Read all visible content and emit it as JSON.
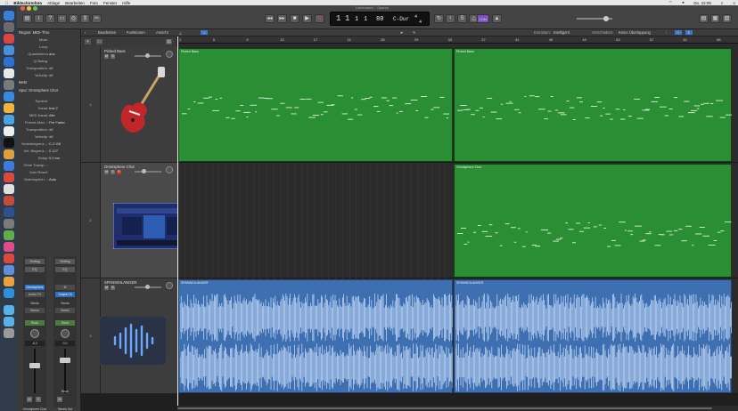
{
  "menubar": {
    "app": "Bildschirmfoto",
    "items": [
      "Ablage",
      "Bearbeiten",
      "Foto",
      "Fenster",
      "Hilfe"
    ],
    "clock": "Do. 22:05"
  },
  "window": {
    "title": "Unbenannt – Spuren"
  },
  "transport": {
    "bars": "1",
    "beat": "1",
    "div": "1",
    "tick": "1",
    "tempo": "80",
    "key": "C-Dur",
    "signature_top": "4",
    "signature_bottom": "4",
    "cpu_label": "1234"
  },
  "inspector": {
    "region_header": "Region: MIDI-Thru",
    "region_rows": [
      {
        "k": "Mute:",
        "v": ""
      },
      {
        "k": "Loop:",
        "v": ""
      },
      {
        "k": "Quantisieren",
        "v": "aus"
      },
      {
        "k": "Q-Swing:",
        "v": ""
      },
      {
        "k": "Transposition:",
        "v": "±0"
      },
      {
        "k": "Velocity:",
        "v": "±0"
      }
    ],
    "more_label": "Mehr",
    "track_header": "Spur: Omnisphere Chor",
    "track_rows": [
      {
        "k": "Symbol:",
        "v": ""
      },
      {
        "k": "Kanal:",
        "v": "Inst 2"
      },
      {
        "k": "MIDI-Kanal:",
        "v": "Alle"
      },
      {
        "k": "Freeze-Mod...:",
        "v": "Pre Fader"
      },
      {
        "k": "Transposition:",
        "v": "±0"
      },
      {
        "k": "Velocity:",
        "v": "±0"
      },
      {
        "k": "Notenbegrenz...:",
        "v": "C-2  G8"
      },
      {
        "k": "Vel.-Begrenz...:",
        "v": "0  127"
      },
      {
        "k": "Delay:",
        "v": "0,0 ms"
      },
      {
        "k": "Ohne Transp...:",
        "v": ""
      },
      {
        "k": "Kein Reset:",
        "v": ""
      },
      {
        "k": "Notenspeich...:",
        "v": "Auto"
      }
    ],
    "strip_a": {
      "setting": "Setting",
      "eq": "EQ",
      "plugin": "Omnisphere",
      "group": "Audio FX",
      "send": "Sends",
      "out": "Stereo",
      "read": "Read",
      "vol": "-6,2",
      "name": "Omnisphere Chor",
      "mute": "M",
      "solo": "S"
    },
    "strip_b": {
      "setting": "Setting",
      "eq": "EQ",
      "plugin": "Ø",
      "group": "Output Ch",
      "send": "Sends",
      "out": "Stereo",
      "read": "Read",
      "vol": "0,0",
      "name": "Stereo Out",
      "bnc": "Bnce",
      "mute": "M"
    }
  },
  "editbar": {
    "edit": "Bearbeiten",
    "functions": "Funktionen",
    "view": "Ansicht",
    "snap_label": "Einrasten:",
    "snap_value": "Intelligent",
    "drag_label": "Verschieben:",
    "drag_value": "Keine Überlappung"
  },
  "ruler": [
    "1",
    "5",
    "9",
    "13",
    "17",
    "21",
    "25",
    "29",
    "33",
    "37",
    "41",
    "45",
    "49",
    "53",
    "57",
    "61",
    "65"
  ],
  "tracks": [
    {
      "num": "1",
      "name": "Picked Bass",
      "mute": "M",
      "solo": "S"
    },
    {
      "num": "2",
      "name": "Omnisphere Chor",
      "mute": "M",
      "solo": "S",
      "rec": "R"
    },
    {
      "num": "3",
      "name": "SPANNDILANGER",
      "mute": "M",
      "solo": "S"
    }
  ],
  "regions": [
    {
      "track": 0,
      "label": "Picked Bass"
    },
    {
      "track": 0,
      "label": "Picked Bass"
    },
    {
      "track": 1,
      "label": "Omnisphere Chor"
    },
    {
      "track": 2,
      "label": "SPANNDILANGER"
    },
    {
      "track": 2,
      "label": "SPANNDILANGER"
    }
  ],
  "colors": {
    "midi": "#2a8f34",
    "audio": "#3e6fb0",
    "audio_wave": "#bcd3f3",
    "bg": "#2b2b2b"
  }
}
